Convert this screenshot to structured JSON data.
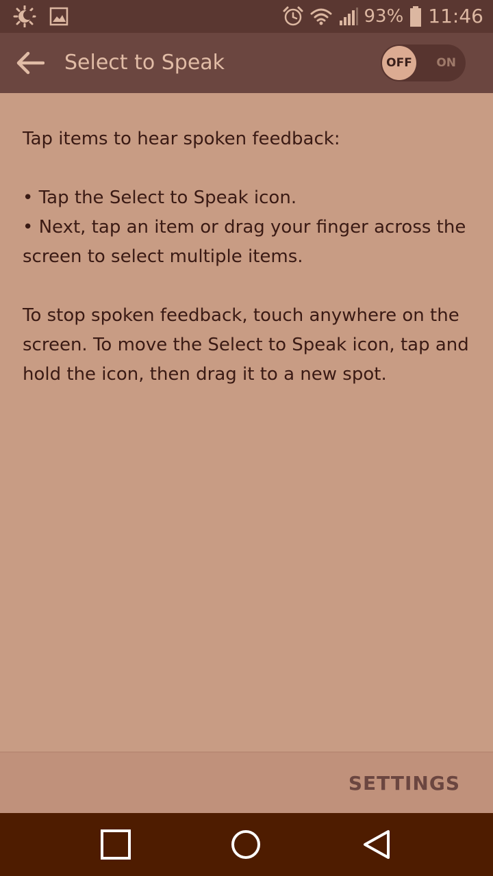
{
  "status_bar": {
    "battery_percent": "93%",
    "time": "11:46",
    "battery_level": 0.93,
    "icons": [
      "brightness-icon",
      "gallery-icon",
      "alarm-icon",
      "wifi-icon",
      "signal-icon",
      "battery-icon"
    ]
  },
  "app_bar": {
    "title": "Select to Speak",
    "toggle_off_label": "OFF",
    "toggle_on_label": "ON",
    "toggle_state": "off"
  },
  "content": {
    "intro": "Tap items to hear spoken feedback:",
    "bullet1": "• Tap the Select to Speak icon.",
    "bullet2": "• Next, tap an item or drag your finger across the screen to select multiple items.",
    "paragraph": "To stop spoken feedback, touch anywhere on the screen. To move the Select to Speak icon, tap and hold the icon, then drag it to a new spot."
  },
  "footer": {
    "settings_label": "SETTINGS"
  },
  "nav_bar": {
    "icons": [
      "recents-icon",
      "home-icon",
      "back-nav-icon"
    ]
  },
  "colors": {
    "status_bar": "#5a3731",
    "app_bar": "#6b4640",
    "background": "#c89c84",
    "text": "#3a1a14",
    "nav_bar": "#4e1c00"
  }
}
